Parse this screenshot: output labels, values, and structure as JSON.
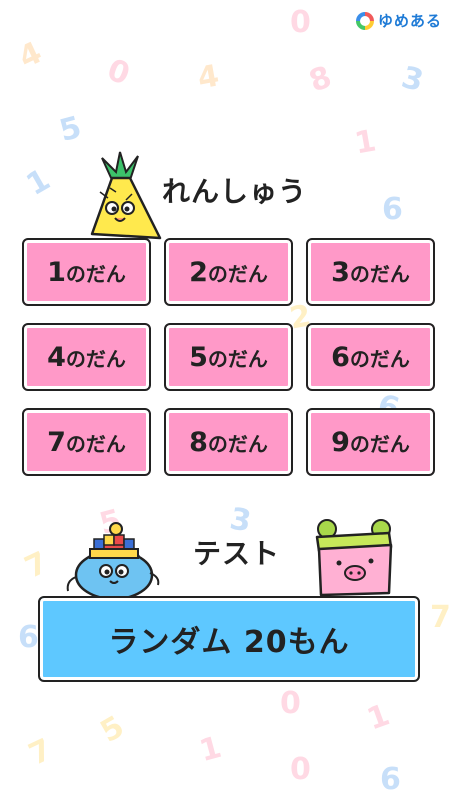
{
  "brand": {
    "name": "ゆめある"
  },
  "practice": {
    "title": "れんしゅう",
    "buttons": [
      {
        "num": "1",
        "suffix": "のだん"
      },
      {
        "num": "2",
        "suffix": "のだん"
      },
      {
        "num": "3",
        "suffix": "のだん"
      },
      {
        "num": "4",
        "suffix": "のだん"
      },
      {
        "num": "5",
        "suffix": "のだん"
      },
      {
        "num": "6",
        "suffix": "のだん"
      },
      {
        "num": "7",
        "suffix": "のだん"
      },
      {
        "num": "8",
        "suffix": "のだん"
      },
      {
        "num": "9",
        "suffix": "のだん"
      }
    ]
  },
  "test": {
    "title": "テスト",
    "random_button": "ランダム 20もん"
  },
  "colors": {
    "practice_button": "#ff99c8",
    "test_button": "#5ec8ff",
    "logo_text": "#1f7bd6"
  },
  "icons": [
    "pineapple-character-icon",
    "blue-blob-character-icon",
    "pink-pig-character-icon",
    "yumearu-logo-icon"
  ]
}
